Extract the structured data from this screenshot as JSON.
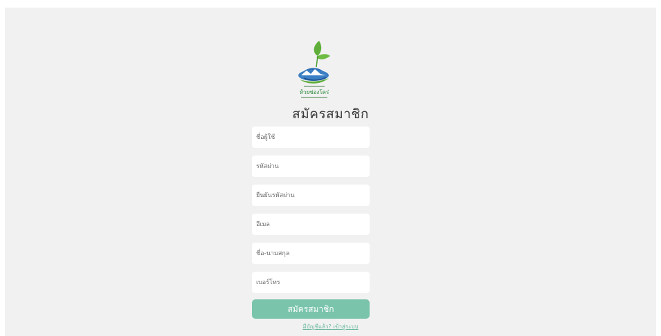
{
  "form": {
    "title": "สมัครสมาชิก",
    "fields": [
      {
        "name": "username",
        "placeholder": "ชื่อผู้ใช้",
        "value": ""
      },
      {
        "name": "password",
        "placeholder": "รหัสผ่าน",
        "value": ""
      },
      {
        "name": "confirm_password",
        "placeholder": "ยืนยันรหัสผ่าน",
        "value": ""
      },
      {
        "name": "email",
        "placeholder": "อีเมล",
        "value": ""
      },
      {
        "name": "fullname",
        "placeholder": "ชื่อ-นามสกุล",
        "value": ""
      },
      {
        "name": "phone",
        "placeholder": "เบอร์โทร",
        "value": ""
      }
    ],
    "submit_label": "สมัครสมาชิก",
    "login_link": "มีบัญชีแล้ว? เข้าสู่ระบบ"
  },
  "logo": {
    "name": "ห้วยซ่องโคร่",
    "colors": {
      "leaf": "#5fae3a",
      "water": "#2f6db5",
      "text": "#2a8a3a"
    }
  }
}
